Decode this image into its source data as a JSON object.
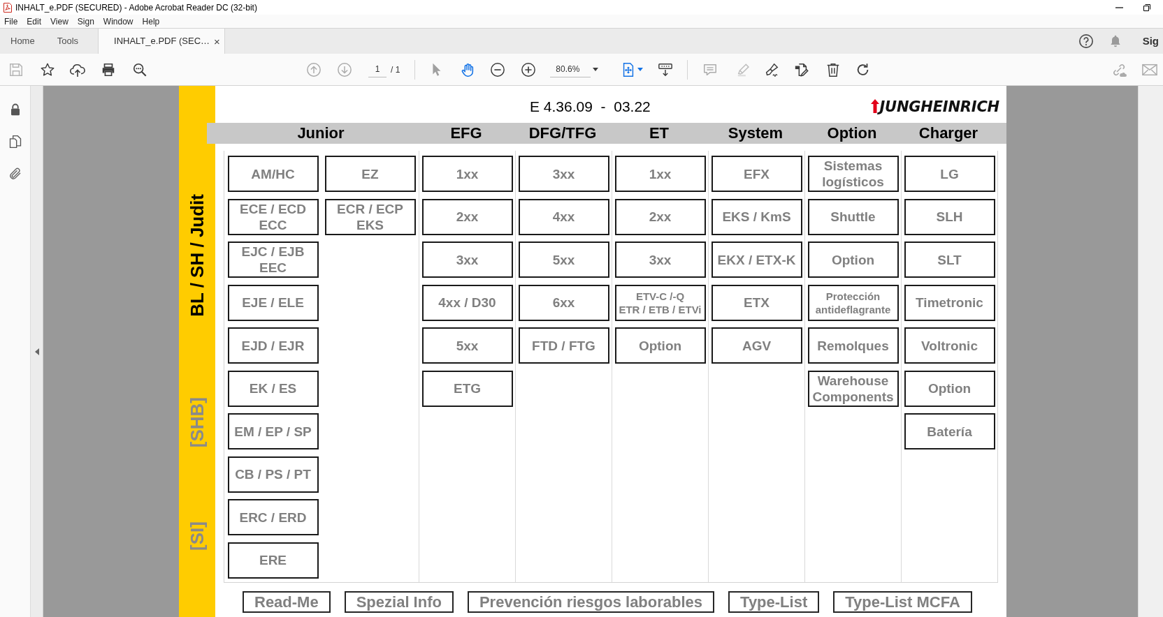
{
  "window": {
    "title": "INHALT_e.PDF (SECURED) - Adobe Acrobat Reader DC (32-bit)"
  },
  "menu_bar": [
    "File",
    "Edit",
    "View",
    "Sign",
    "Window",
    "Help"
  ],
  "tabs": [
    {
      "label": "Home",
      "selected": false
    },
    {
      "label": "Tools",
      "selected": false
    },
    {
      "label": "INHALT_e.PDF (SEC…",
      "selected": true,
      "close": "×"
    }
  ],
  "account": {
    "sign_in": "Sig"
  },
  "toolbar": {
    "page_field": {
      "value": "1"
    },
    "page_total": "/ 1",
    "zoom_field": {
      "value": "80.6%"
    },
    "cursor_tools": [
      {
        "selected": false
      },
      {
        "selected": true
      }
    ]
  },
  "document": {
    "side_labels": [
      {
        "text": "BL / SH / Judit",
        "kind": "primary"
      },
      {
        "text": "[SHB]",
        "kind": "secondary"
      },
      {
        "text": "[SI]",
        "kind": "secondary"
      }
    ],
    "version": "E 4.36.09  -  03.22",
    "logo": "JUNGHEINRICH",
    "groups": [
      {
        "header": "Junior",
        "columns": [
          [
            {
              "label": "AM/HC"
            },
            {
              "label": "ECE / ECD\nECC"
            },
            {
              "label": "EJC / EJB\nEEC"
            },
            {
              "label": "EJE / ELE"
            },
            {
              "label": "EJD / EJR"
            },
            {
              "label": "EK / ES"
            },
            {
              "label": "EM / EP / SP"
            },
            {
              "label": "CB / PS / PT"
            },
            {
              "label": "ERC / ERD"
            },
            {
              "label": "ERE"
            }
          ],
          [
            {
              "label": "EZ"
            },
            {
              "label": "ECR / ECP\nEKS"
            }
          ]
        ]
      },
      {
        "header": "EFG",
        "columns": [
          [
            {
              "label": "1xx"
            },
            {
              "label": "2xx"
            },
            {
              "label": "3xx"
            },
            {
              "label": "4xx / D30"
            },
            {
              "label": "5xx"
            },
            {
              "label": "ETG"
            }
          ]
        ]
      },
      {
        "header": "DFG/TFG",
        "columns": [
          [
            {
              "label": "3xx"
            },
            {
              "label": "4xx"
            },
            {
              "label": "5xx"
            },
            {
              "label": "6xx"
            },
            {
              "label": "FTD / FTG"
            }
          ]
        ]
      },
      {
        "header": "ET",
        "columns": [
          [
            {
              "label": "1xx"
            },
            {
              "label": "2xx"
            },
            {
              "label": "3xx"
            },
            {
              "label": "ETV-C /-Q\nETR / ETB / ETVi",
              "compact": true
            },
            {
              "label": "Option"
            }
          ]
        ]
      },
      {
        "header": "System",
        "columns": [
          [
            {
              "label": "EFX"
            },
            {
              "label": "EKS / KmS"
            },
            {
              "label": "EKX / ETX-K"
            },
            {
              "label": "ETX"
            },
            {
              "label": "AGV"
            }
          ]
        ]
      },
      {
        "header": "Option",
        "columns": [
          [
            {
              "label": "Sistemas\nlogísticos"
            },
            {
              "label": "Shuttle"
            },
            {
              "label": "Option"
            },
            {
              "label": "Protección\nantideflagrante",
              "compact": true
            },
            {
              "label": "Remolques"
            },
            {
              "label": "Warehouse\nComponents"
            }
          ]
        ]
      },
      {
        "header": "Charger",
        "columns": [
          [
            {
              "label": "LG"
            },
            {
              "label": "SLH"
            },
            {
              "label": "SLT"
            },
            {
              "label": "Timetronic"
            },
            {
              "label": "Voltronic"
            },
            {
              "label": "Option"
            },
            {
              "label": "Batería"
            }
          ]
        ]
      }
    ],
    "links": [
      "Read-Me",
      "Spezial Info",
      "Prevención riesgos laborables",
      "Type-List",
      "Type-List MCFA"
    ]
  }
}
